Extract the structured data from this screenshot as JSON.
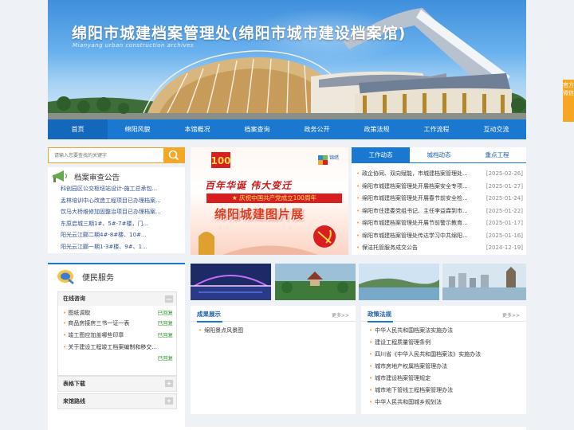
{
  "banner": {
    "title": "绵阳市城建档案管理处(绵阳市城市建设档案馆)",
    "subtitle": "Mianyang urban construction archives"
  },
  "nav": [
    "首页",
    "绵阳风貌",
    "本馆概况",
    "档案查询",
    "政务公开",
    "政策法规",
    "工作流程",
    "互动交流"
  ],
  "search": {
    "placeholder": "请输入您要查找的关键字"
  },
  "notice": {
    "title": "档案审查公告",
    "items": [
      "科创园区公交枢纽站设计-施工总承包...",
      "孟林培训中心改造工程项目已办理档案...",
      "饮马大桥维修加固整治项目已办理档案...",
      "东原启城三期1#、5#-7#楼，门...",
      "阳光云江郦二期4#-8#楼、10#...",
      "阳光云江郦一期1-3#楼、9#、1..."
    ]
  },
  "slider": {
    "badge": "锦绣",
    "slogan": "百年华诞 伟大变迁",
    "ribbon": "★ 庆祝中国共产党成立100周年",
    "bigtext": "绵阳城建图片展"
  },
  "news": {
    "tabs": [
      "工作动态",
      "城档动态",
      "重点工程"
    ],
    "items": [
      {
        "title": "政企协同、双向赋能，市城建档案管理处...",
        "date": "[2025-02-26]"
      },
      {
        "title": "绵阳市城建档案管理处开展档案安全专项...",
        "date": "[2025-01-27]"
      },
      {
        "title": "绵阳市城建档案管理处开展春节前安全检...",
        "date": "[2025-01-24]"
      },
      {
        "title": "绵阳市住建委党组书记、主任李益霖到市...",
        "date": "[2025-01-22]"
      },
      {
        "title": "绵阳市城建档案管理处开展节前警示教育...",
        "date": "[2025-01-17]"
      },
      {
        "title": "绵阳市城建档案管理处传达学习中共绵阳...",
        "date": "[2025-01-16]"
      },
      {
        "title": "保洁托管服务成交公告",
        "date": "[2024-12-19]"
      }
    ]
  },
  "convenience": {
    "title": "便民服务",
    "online": {
      "header": "在线咨询",
      "items": [
        {
          "q": "图纸调取",
          "status": "已回复"
        },
        {
          "q": "商品房接房三书一证一表",
          "status": "已回复"
        },
        {
          "q": "竣工图应加盖哪些印章",
          "status": "已回复"
        },
        {
          "q": "关于建设工程竣工档案编制和移交...",
          "status": "已回复"
        }
      ]
    },
    "forms_header": "表格下载",
    "route_header": "来馆路线",
    "toggle_minus": "—",
    "toggle_plus": "+"
  },
  "achievements": {
    "title": "成果展示",
    "more": "更多>>",
    "items": [
      "绵阳景点风景图"
    ]
  },
  "policies": {
    "title": "政策法规",
    "more": "更多>>",
    "items": [
      "中华人民共和国档案法实施办法",
      "建设工程质量管理条例",
      "四川省《中华人民共和国档案法》实施办法",
      "城市房地产权属档案管理办法",
      "城市建设档案管理规定",
      "城市地下管线工程档案管理办法",
      "中华人民共和国城乡规划法"
    ]
  },
  "float_label": "官方微信",
  "colors": {
    "nav": "#1a78d0",
    "accent": "#f5a623"
  }
}
